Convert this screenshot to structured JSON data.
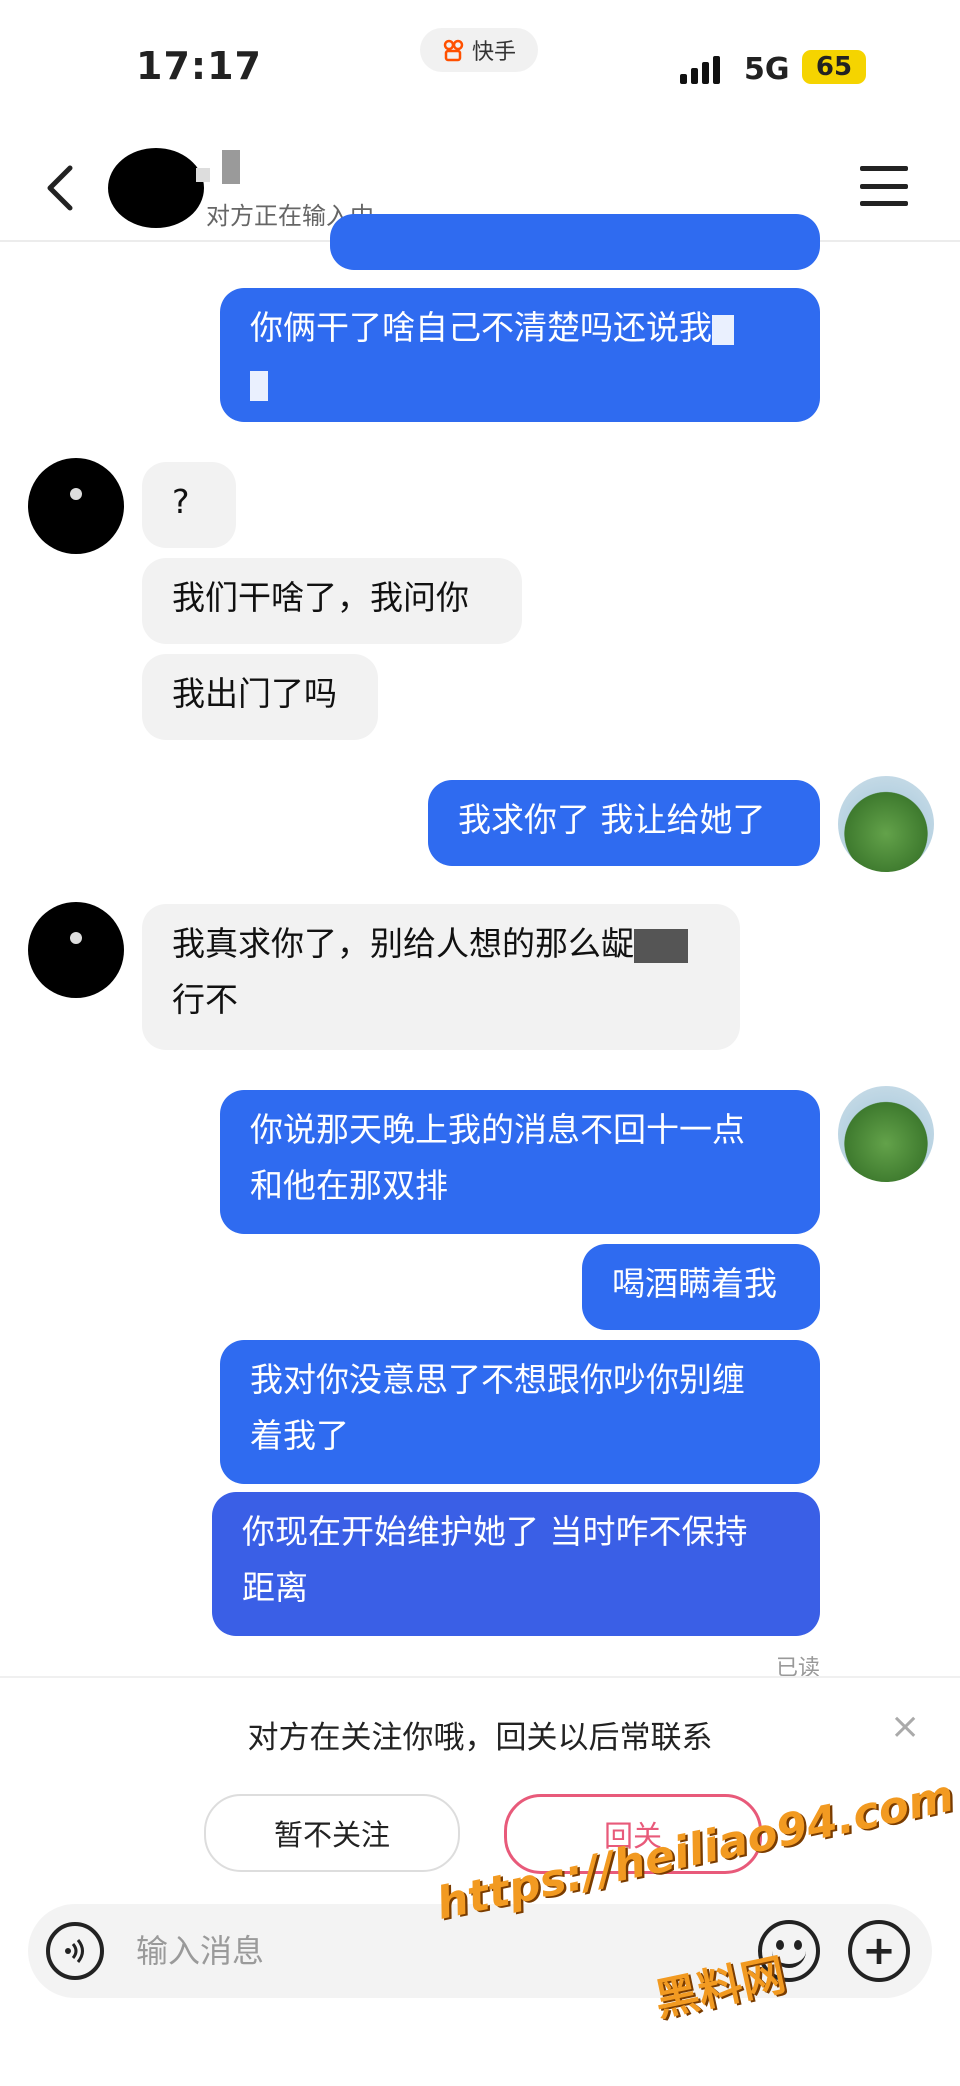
{
  "status_bar": {
    "time": "17:17",
    "app_name": "快手",
    "network": "5G",
    "battery": "65"
  },
  "header": {
    "status_text": "对方正在输入中..."
  },
  "messages": [
    {
      "side": "out",
      "text": "你俩干了啥自己不清楚吗还说我"
    },
    {
      "side": "in",
      "text": "?"
    },
    {
      "side": "in",
      "text": "我们干啥了，我问你"
    },
    {
      "side": "in",
      "text": "我出门了吗"
    },
    {
      "side": "out",
      "text": "我求你了 我让给她了"
    },
    {
      "side": "in",
      "text": "我真求你了，别给人想的那么龊"
    },
    {
      "side": "in",
      "text": "行不"
    },
    {
      "side": "out",
      "text": "你说那天晚上我的消息不回十一点"
    },
    {
      "side": "out",
      "text": "和他在那双排"
    },
    {
      "side": "out",
      "text": "喝酒瞒着我"
    },
    {
      "side": "out",
      "text": "我对你没意思了不想跟你吵你别缠"
    },
    {
      "side": "out",
      "text": "着我了"
    },
    {
      "side": "out",
      "text": "你现在开始维护她了 当时咋不保持"
    },
    {
      "side": "out",
      "text": "距离"
    }
  ],
  "read_receipt": "已读",
  "follow_prompt": {
    "text": "对方在关注你哦，回关以后常联系",
    "skip_label": "暂不关注",
    "follow_label": "回关",
    "close_icon": "×"
  },
  "input_bar": {
    "placeholder": "输入消息",
    "voice_icon": "voice-icon",
    "emoji_icon": "emoji-icon",
    "plus_icon": "+"
  },
  "watermark": {
    "url": "https://heiliao94.com",
    "brand": "黑料网"
  },
  "colors": {
    "outgoing_bubble": "#2f6bf0",
    "incoming_bubble": "#f2f2f2",
    "follow_accent": "#e85a7a",
    "battery": "#f5d400"
  }
}
